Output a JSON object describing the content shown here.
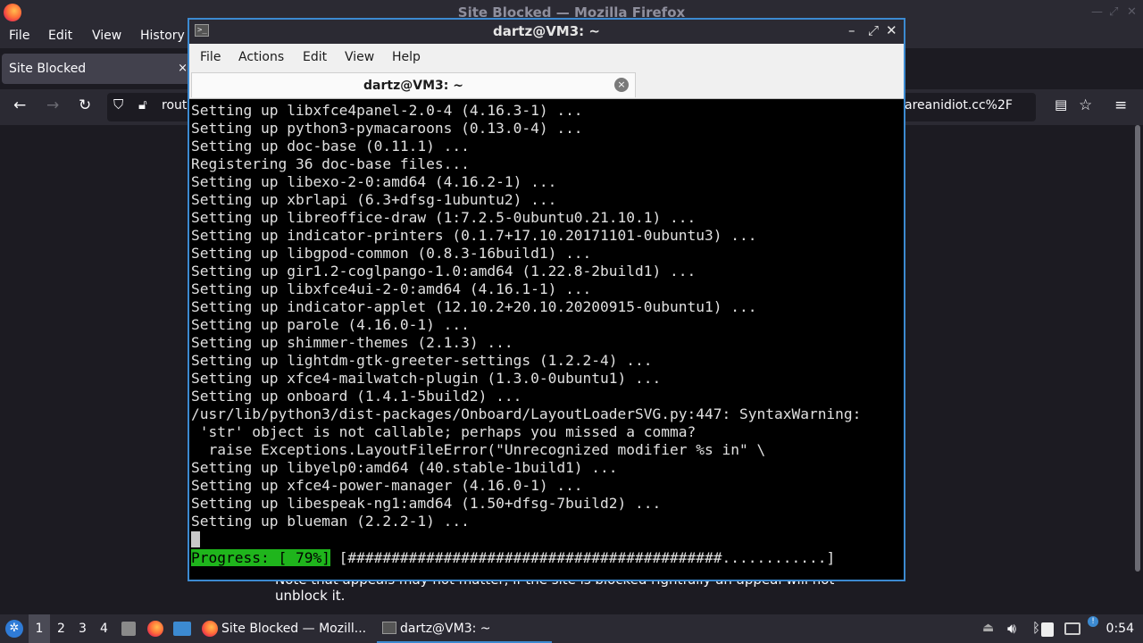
{
  "firefox": {
    "window_title": "Site Blocked — Mozilla Firefox",
    "menu": [
      "File",
      "Edit",
      "View",
      "History"
    ],
    "tab_title": "Site Blocked",
    "tab_close": "×",
    "url_left": "rout",
    "url_right": "areanidiot.cc%2F",
    "body_text": "Note that appeals may not matter, if the site is blocked rightfully an appeal will not unblock it."
  },
  "terminal": {
    "title": "dartz@VM3: ~",
    "icon_glyph": ">_",
    "menu": [
      "File",
      "Actions",
      "Edit",
      "View",
      "Help"
    ],
    "tab_label": "dartz@VM3: ~",
    "tab_close": "×",
    "output_lines": [
      "Setting up libxfce4panel-2.0-4 (4.16.3-1) ...",
      "Setting up python3-pymacaroons (0.13.0-4) ...",
      "Setting up doc-base (0.11.1) ...",
      "Registering 36 doc-base files...",
      "Setting up libexo-2-0:amd64 (4.16.2-1) ...",
      "Setting up xbrlapi (6.3+dfsg-1ubuntu2) ...",
      "Setting up libreoffice-draw (1:7.2.5-0ubuntu0.21.10.1) ...",
      "Setting up indicator-printers (0.1.7+17.10.20171101-0ubuntu3) ...",
      "Setting up libgpod-common (0.8.3-16build1) ...",
      "Setting up gir1.2-coglpango-1.0:amd64 (1.22.8-2build1) ...",
      "Setting up libxfce4ui-2-0:amd64 (4.16.1-1) ...",
      "Setting up indicator-applet (12.10.2+20.10.20200915-0ubuntu1) ...",
      "Setting up parole (4.16.0-1) ...",
      "Setting up shimmer-themes (2.1.3) ...",
      "Setting up lightdm-gtk-greeter-settings (1.2.2-4) ...",
      "Setting up xfce4-mailwatch-plugin (1.3.0-0ubuntu1) ...",
      "Setting up onboard (1.4.1-5build2) ...",
      "/usr/lib/python3/dist-packages/Onboard/LayoutLoaderSVG.py:447: SyntaxWarning:",
      " 'str' object is not callable; perhaps you missed a comma?",
      "  raise Exceptions.LayoutFileError(\"Unrecognized modifier %s in\" \\",
      "Setting up libyelp0:amd64 (40.stable-1build1) ...",
      "Setting up xfce4-power-manager (4.16.0-1) ...",
      "Setting up libespeak-ng1:amd64 (1.50+dfsg-7build2) ...",
      "Setting up blueman (2.2.2-1) ..."
    ],
    "progress_label": "Progress: [ 79%]",
    "progress_bar": " [###########################################............] ",
    "progress_percent": 79
  },
  "taskbar": {
    "workspaces": [
      "1",
      "2",
      "3",
      "4"
    ],
    "active_workspace": "1",
    "tasks": [
      {
        "label": "Site Blocked — Mozill...",
        "icon": "firefox-icon"
      },
      {
        "label": "dartz@VM3: ~",
        "icon": "terminal-icon"
      }
    ],
    "clock": "0:54"
  },
  "colors": {
    "accent": "#3c8ad1",
    "progress_green": "#1fb51c",
    "terminal_bg": "#000000",
    "firefox_bg": "#1c1b22"
  }
}
